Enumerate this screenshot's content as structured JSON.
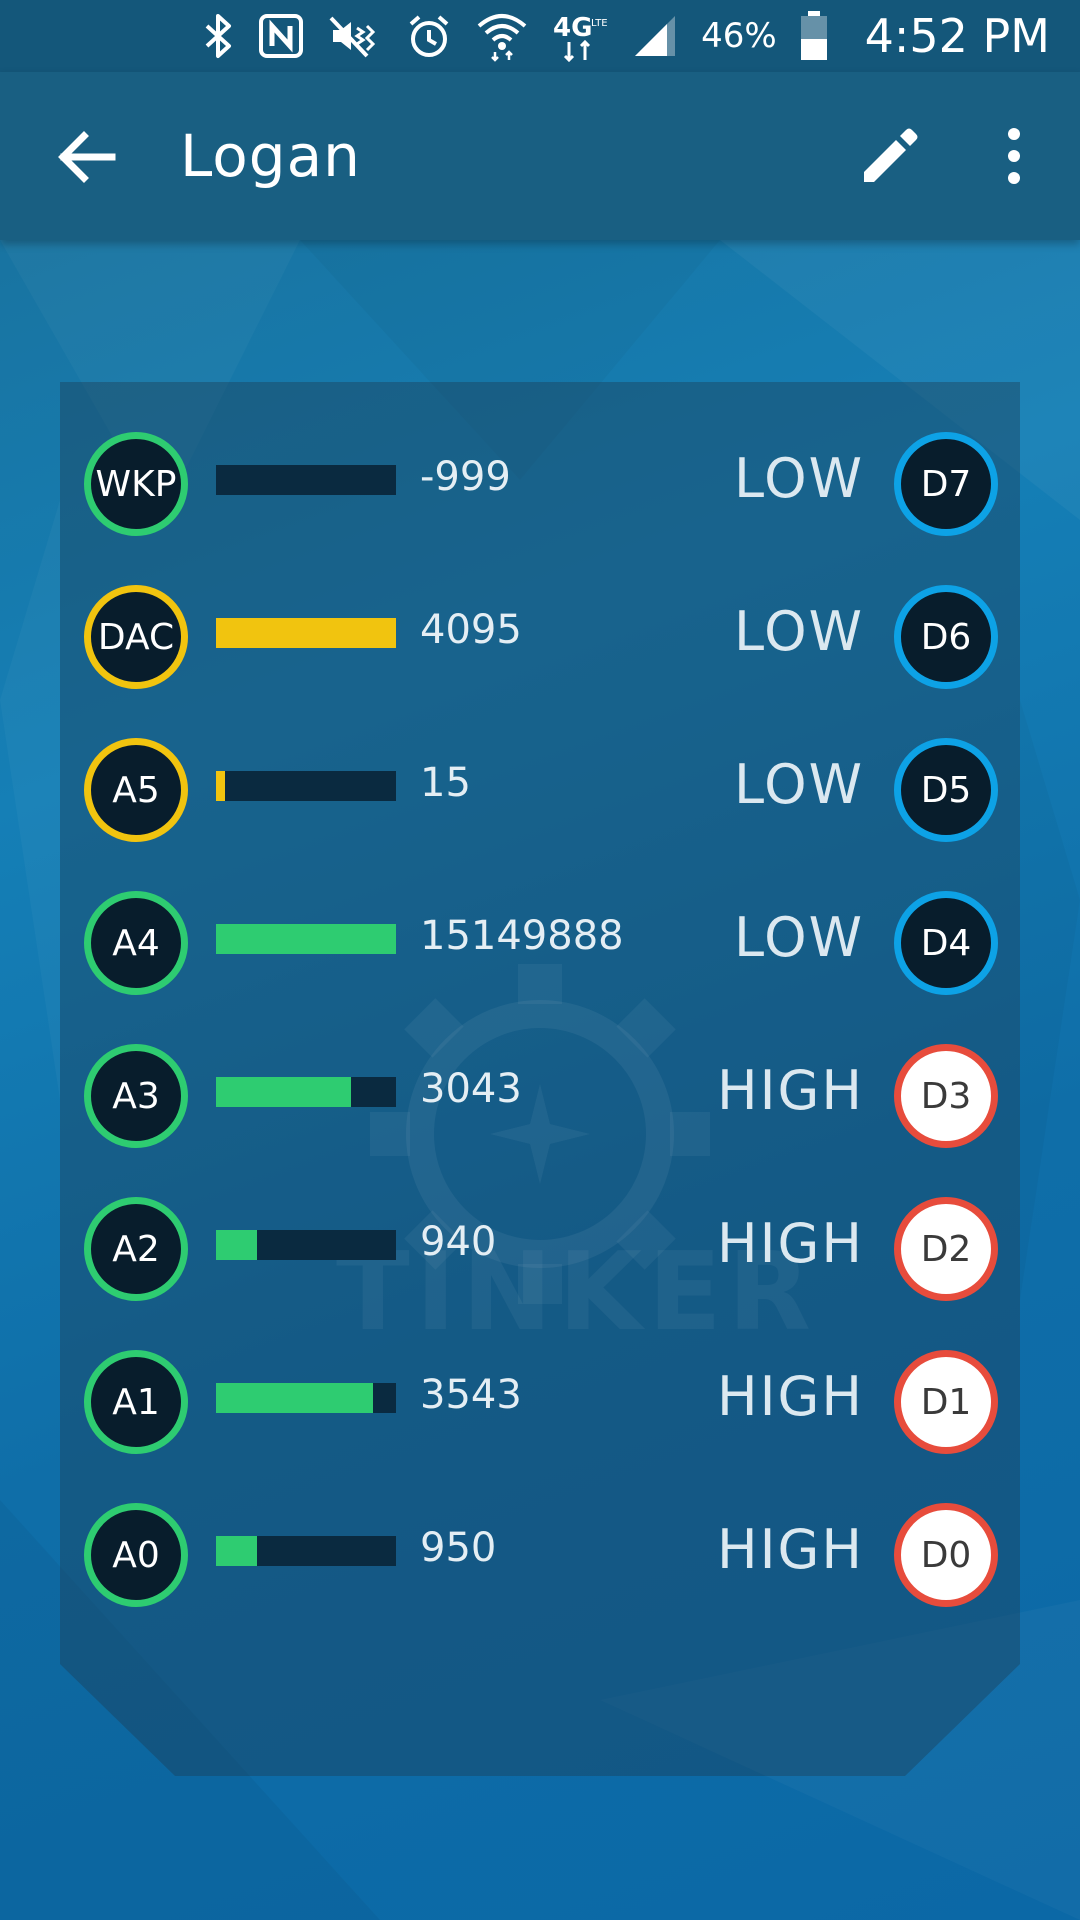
{
  "status_bar": {
    "battery": "46%",
    "time": "4:52 PM",
    "icons": [
      "bluetooth-icon",
      "nfc-icon",
      "vibrate-icon",
      "alarm-icon",
      "wifi-icon",
      "lte-icon",
      "signal-icon",
      "battery-icon"
    ]
  },
  "app_bar": {
    "title": "Logan",
    "icons": [
      "back-arrow-icon",
      "edit-pencil-icon",
      "more-vert-icon"
    ]
  },
  "watermark": "TINKER",
  "colors": {
    "analog_green": "#2ecc71",
    "analog_yellow": "#f1c40f",
    "digital_low_blue": "#0da2e6",
    "digital_high_red": "#e74c3c",
    "bar_track": "#0a2a40"
  },
  "analog_pins": [
    {
      "label": "WKP",
      "value": "-999",
      "fill": 0,
      "color": "#2ecc71"
    },
    {
      "label": "DAC",
      "value": "4095",
      "fill": 1,
      "color": "#f1c40f"
    },
    {
      "label": "A5",
      "value": "15",
      "fill": 0.05,
      "color": "#f1c40f"
    },
    {
      "label": "A4",
      "value": "15149888",
      "fill": 1,
      "color": "#2ecc71"
    },
    {
      "label": "A3",
      "value": "3043",
      "fill": 0.75,
      "color": "#2ecc71"
    },
    {
      "label": "A2",
      "value": "940",
      "fill": 0.23,
      "color": "#2ecc71"
    },
    {
      "label": "A1",
      "value": "3543",
      "fill": 0.87,
      "color": "#2ecc71"
    },
    {
      "label": "A0",
      "value": "950",
      "fill": 0.23,
      "color": "#2ecc71"
    }
  ],
  "digital_pins": [
    {
      "label": "D7",
      "state": "LOW"
    },
    {
      "label": "D6",
      "state": "LOW"
    },
    {
      "label": "D5",
      "state": "LOW"
    },
    {
      "label": "D4",
      "state": "LOW"
    },
    {
      "label": "D3",
      "state": "HIGH"
    },
    {
      "label": "D2",
      "state": "HIGH"
    },
    {
      "label": "D1",
      "state": "HIGH"
    },
    {
      "label": "D0",
      "state": "HIGH"
    }
  ]
}
